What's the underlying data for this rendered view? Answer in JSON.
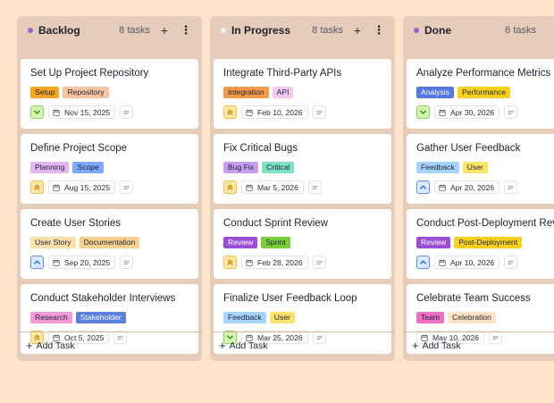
{
  "colors": {
    "background": "#fde4cc",
    "column": "#e6ccbb",
    "card": "#ffffff"
  },
  "add_task_label": "Add Task",
  "columns": [
    {
      "title": "Backlog",
      "count": "8 tasks",
      "dot_color": "#9b5fd6",
      "cards": [
        {
          "title": "Set Up Project Repository",
          "tags": [
            {
              "label": "Setup",
              "color": "#f5a623"
            },
            {
              "label": "Repository",
              "color": "#f9c5a0"
            }
          ],
          "priority": "low",
          "date": "Nov 15, 2025"
        },
        {
          "title": "Define Project Scope",
          "tags": [
            {
              "label": "Planning",
              "color": "#e4b6f2"
            },
            {
              "label": "Scope",
              "color": "#7ea8ff"
            }
          ],
          "priority": "medium",
          "date": "Aug 15, 2025"
        },
        {
          "title": "Create User Stories",
          "tags": [
            {
              "label": "User Story",
              "color": "#fde0a8"
            },
            {
              "label": "Documentation",
              "color": "#f9d08e"
            }
          ],
          "priority": "high",
          "date": "Sep 20, 2025"
        },
        {
          "title": "Conduct Stakeholder Interviews",
          "tags": [
            {
              "label": "Research",
              "color": "#f49ad8"
            },
            {
              "label": "Stakeholder",
              "color": "#5b7fe0"
            }
          ],
          "priority": "medium",
          "date": "Oct 5, 2025"
        }
      ]
    },
    {
      "title": "In Progress",
      "count": "8 tasks",
      "dot_color": "#f2f2f2",
      "cards": [
        {
          "title": "Integrate Third-Party APIs",
          "tags": [
            {
              "label": "Integration",
              "color": "#f59a4a"
            },
            {
              "label": "API",
              "color": "#f6c9f4"
            }
          ],
          "priority": "medium",
          "date": "Feb 10, 2026"
        },
        {
          "title": "Fix Critical Bugs",
          "tags": [
            {
              "label": "Bug Fix",
              "color": "#c79ef0"
            },
            {
              "label": "Critical",
              "color": "#7fe0c6"
            }
          ],
          "priority": "medium",
          "date": "Mar 5, 2026"
        },
        {
          "title": "Conduct Sprint Review",
          "tags": [
            {
              "label": "Review",
              "color": "#9b4fd9"
            },
            {
              "label": "Sprint",
              "color": "#7bd03a"
            }
          ],
          "priority": "medium",
          "date": "Feb 28, 2026"
        },
        {
          "title": "Finalize User Feedback Loop",
          "tags": [
            {
              "label": "Feedback",
              "color": "#a7d4ff"
            },
            {
              "label": "User",
              "color": "#fde36a"
            }
          ],
          "priority": "low",
          "date": "Mar 25, 2026"
        }
      ]
    },
    {
      "title": "Done",
      "count": "6 tasks",
      "dot_color": "#9b5fd6",
      "cards": [
        {
          "title": "Analyze Performance Metrics",
          "tags": [
            {
              "label": "Analysis",
              "color": "#5478e0"
            },
            {
              "label": "Performance",
              "color": "#fbd11d"
            }
          ],
          "priority": "low",
          "date": "Apr 30, 2026"
        },
        {
          "title": "Gather User Feedback",
          "tags": [
            {
              "label": "Feedback",
              "color": "#a7d4ff"
            },
            {
              "label": "User",
              "color": "#fde36a"
            }
          ],
          "priority": "high",
          "date": "Apr 20, 2026"
        },
        {
          "title": "Conduct Post-Deployment Review",
          "tags": [
            {
              "label": "Review",
              "color": "#9b4fd9"
            },
            {
              "label": "Post-Deployment",
              "color": "#fbd11d"
            }
          ],
          "priority": "high",
          "date": "Apr 10, 2026"
        },
        {
          "title": "Celebrate Team Success",
          "tags": [
            {
              "label": "Team",
              "color": "#f06fc4"
            },
            {
              "label": "Celebration",
              "color": "#fde3c4"
            }
          ],
          "priority": "none",
          "date": "May 10, 2026"
        }
      ]
    }
  ]
}
